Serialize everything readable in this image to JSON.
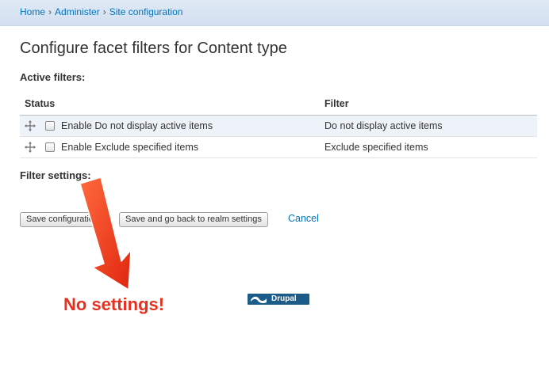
{
  "breadcrumb": {
    "items": [
      "Home",
      "Administer",
      "Site configuration"
    ],
    "separator": "›"
  },
  "page": {
    "title": "Configure facet filters for Content type"
  },
  "active_filters": {
    "label": "Active filters:",
    "columns": [
      "Status",
      "Filter"
    ],
    "rows": [
      {
        "checkbox_label": "Enable Do not display active items",
        "filter": "Do not display active items",
        "checked": false
      },
      {
        "checkbox_label": "Enable Exclude specified items",
        "filter": "Exclude specified items",
        "checked": false
      }
    ]
  },
  "filter_settings": {
    "label": "Filter settings:"
  },
  "actions": {
    "save_label": "Save configuration",
    "save_back_label": "Save and go back to realm settings",
    "cancel_label": "Cancel"
  },
  "annotation": {
    "text": "No settings!",
    "color": "#e8301e"
  },
  "footer": {
    "badge_label": "Drupal"
  },
  "colors": {
    "link": "#0074bd",
    "breadcrumb_bg": "#d3e0f0",
    "row_highlight": "#eef3fa"
  }
}
